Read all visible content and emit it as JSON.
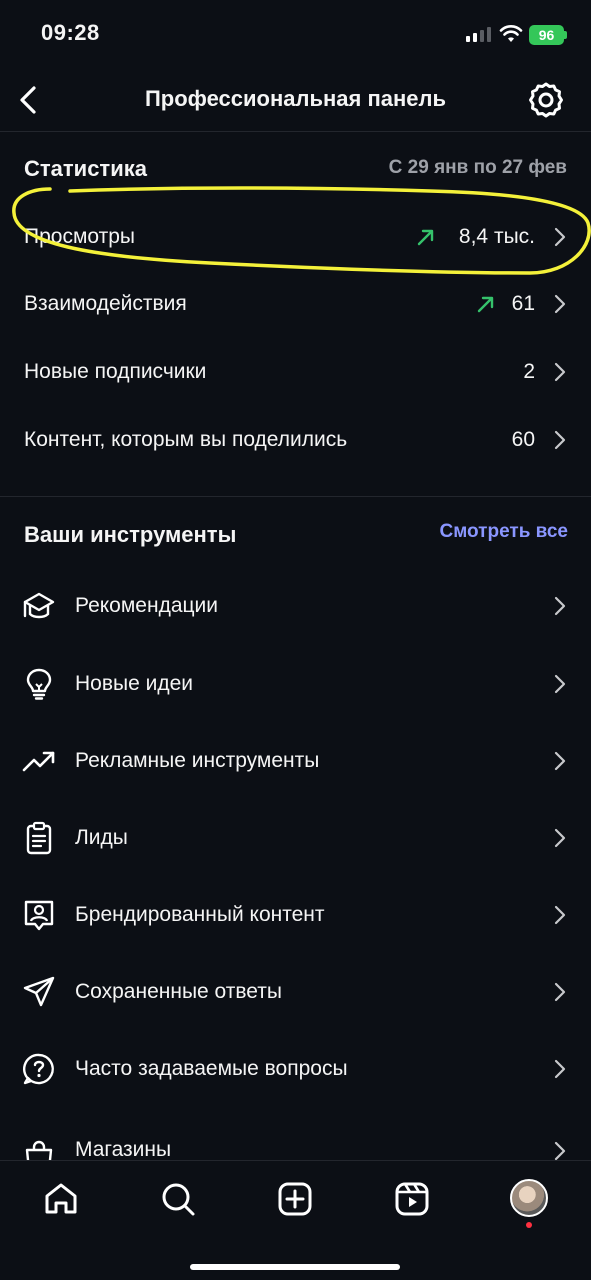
{
  "status_bar": {
    "time": "09:28",
    "battery": "96"
  },
  "nav": {
    "title": "Профессиональная панель"
  },
  "stats": {
    "title": "Статистика",
    "date_range": "С 29 янв по 27 фев",
    "rows": [
      {
        "label": "Просмотры",
        "value": "8,4 тыс.",
        "trend": "up"
      },
      {
        "label": "Взаимодействия",
        "value": "61",
        "trend": "up"
      },
      {
        "label": "Новые подписчики",
        "value": "2"
      },
      {
        "label": "Контент, которым вы поделились",
        "value": "60"
      }
    ]
  },
  "tools": {
    "title": "Ваши инструменты",
    "see_all": "Смотреть все",
    "items": [
      {
        "label": "Рекомендации",
        "icon": "graduation-cap-icon"
      },
      {
        "label": "Новые идеи",
        "icon": "lightbulb-icon"
      },
      {
        "label": "Рекламные инструменты",
        "icon": "trending-up-icon"
      },
      {
        "label": "Лиды",
        "icon": "clipboard-icon"
      },
      {
        "label": "Брендированный контент",
        "icon": "branded-content-icon"
      },
      {
        "label": "Сохраненные ответы",
        "icon": "paper-plane-icon"
      },
      {
        "label": "Часто задаваемые вопросы",
        "icon": "question-icon"
      },
      {
        "label": "Магазины",
        "icon": "shopping-bag-icon"
      }
    ]
  },
  "tabbar": {
    "tabs": [
      "home-icon",
      "search-icon",
      "create-icon",
      "reels-icon",
      "profile-avatar"
    ]
  },
  "colors": {
    "accent": "#8a96ff",
    "trend_up": "#35c26b",
    "highlight": "#f4f13a",
    "background": "#0c0f15"
  }
}
